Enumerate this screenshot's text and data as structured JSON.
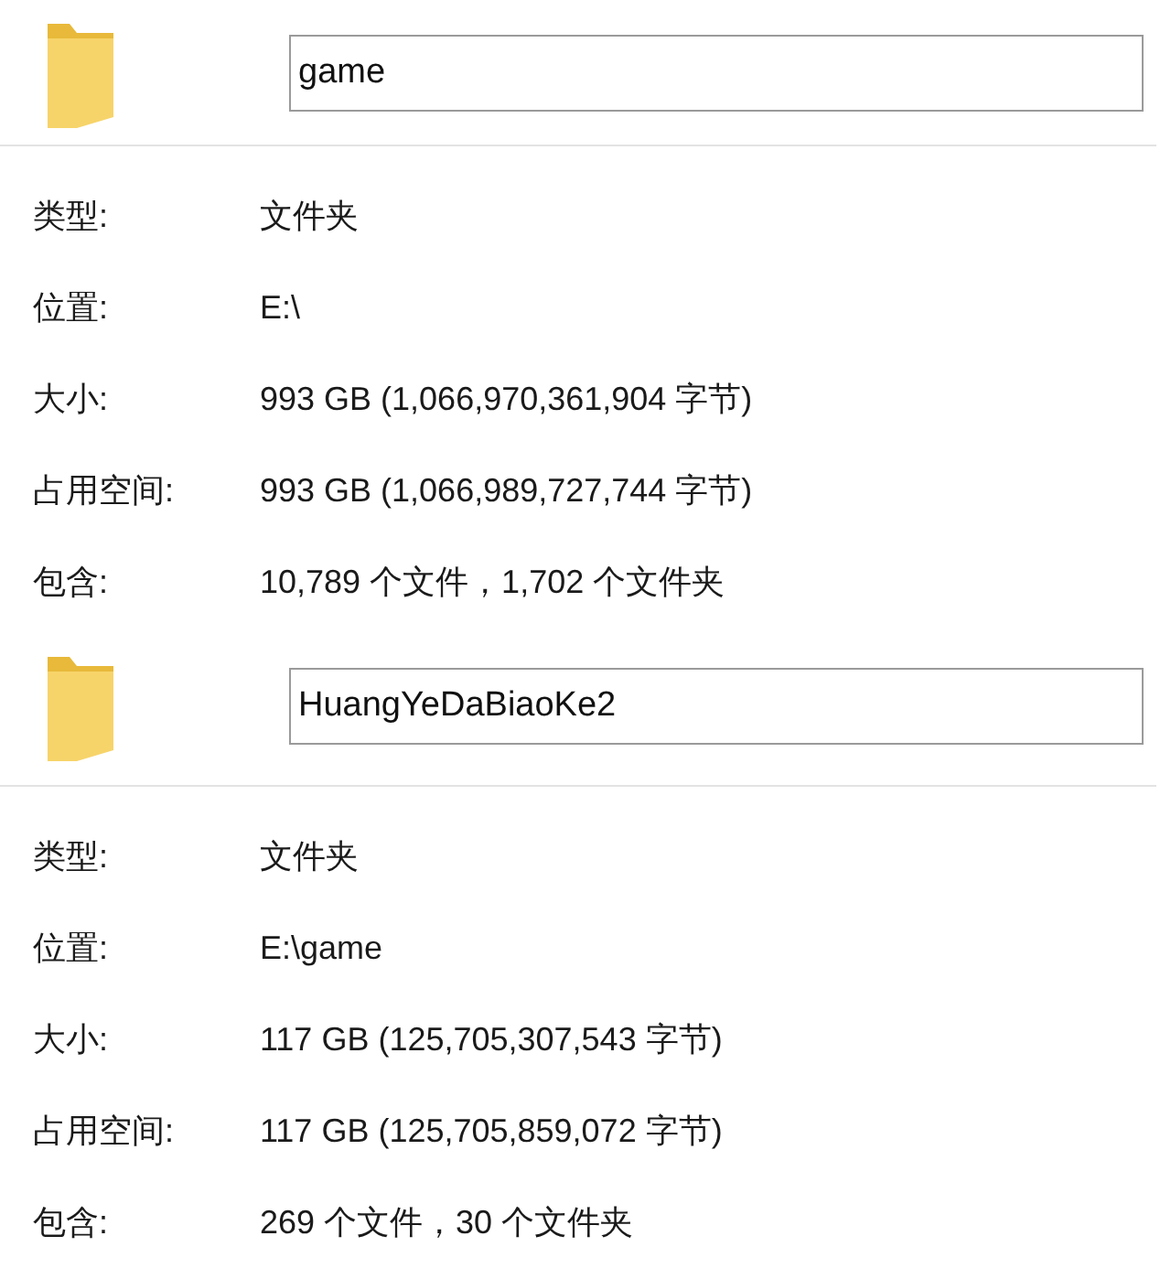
{
  "panels": [
    {
      "name": "game",
      "properties": [
        {
          "label": "类型:",
          "value": "文件夹"
        },
        {
          "label": "位置:",
          "value": "E:\\"
        },
        {
          "label": "大小:",
          "value": "993 GB (1,066,970,361,904 字节)"
        },
        {
          "label": "占用空间:",
          "value": "993 GB (1,066,989,727,744 字节)"
        },
        {
          "label": "包含:",
          "value": "10,789 个文件，1,702 个文件夹"
        }
      ]
    },
    {
      "name": "HuangYeDaBiaoKe2",
      "properties": [
        {
          "label": "类型:",
          "value": "文件夹"
        },
        {
          "label": "位置:",
          "value": "E:\\game"
        },
        {
          "label": "大小:",
          "value": "117 GB (125,705,307,543 字节)"
        },
        {
          "label": "占用空间:",
          "value": "117 GB (125,705,859,072 字节)"
        },
        {
          "label": "包含:",
          "value": "269 个文件，30 个文件夹"
        }
      ]
    }
  ]
}
